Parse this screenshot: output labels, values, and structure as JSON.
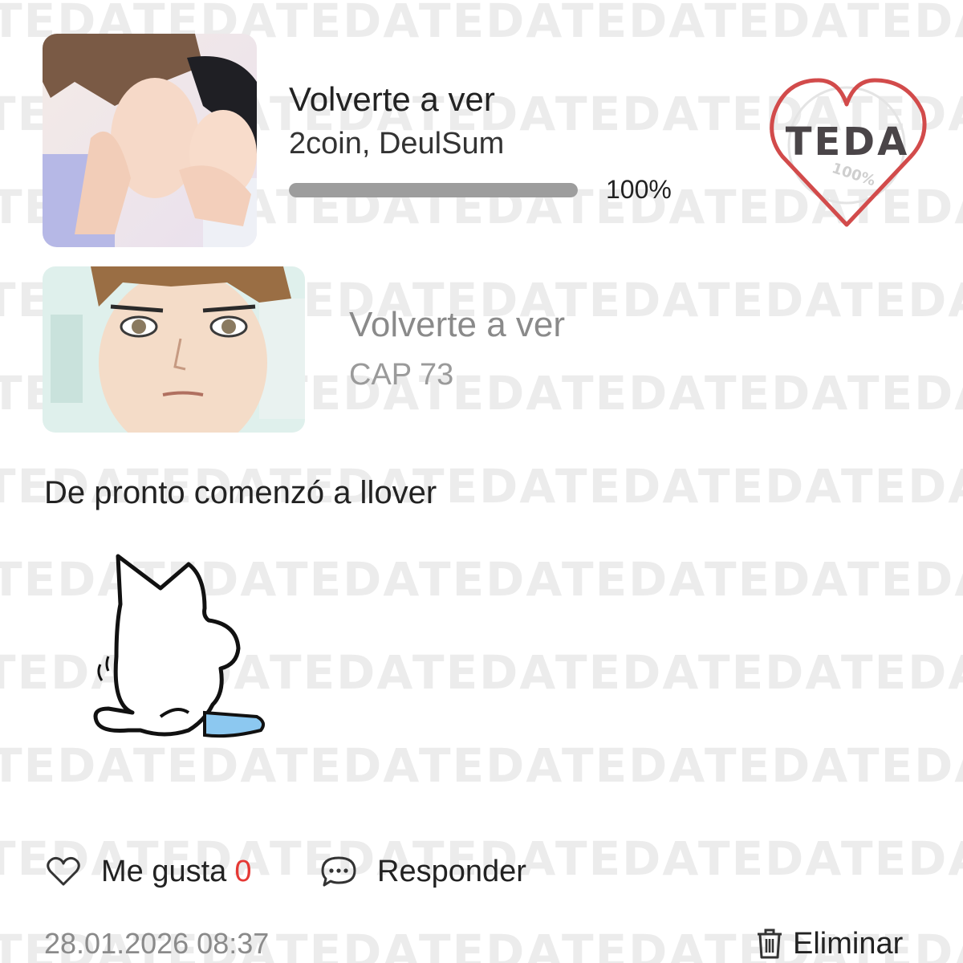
{
  "watermark": {
    "text": "TEDA"
  },
  "series": {
    "title": "Volverte a ver",
    "authors": "2coin, DeulSum",
    "progress_percent": 100,
    "progress_label": "100%",
    "cover_icon": "cover-art"
  },
  "stamp": {
    "text": "TEDA",
    "sub_text": "100%",
    "heart_color": "#d24b4b",
    "icon": "heart-stamp"
  },
  "episode": {
    "title": "Volverte a ver",
    "chapter": "CAP 73",
    "thumb_icon": "episode-thumbnail"
  },
  "comment": {
    "text": "De pronto comenzó a llover",
    "sticker_icon": "cat-sticker"
  },
  "actions": {
    "like_label": "Me gusta",
    "like_count": "0",
    "like_count_color": "#e53935",
    "reply_label": "Responder",
    "delete_label": "Eliminar"
  },
  "meta": {
    "timestamp": "28.01.2026 08:37"
  }
}
